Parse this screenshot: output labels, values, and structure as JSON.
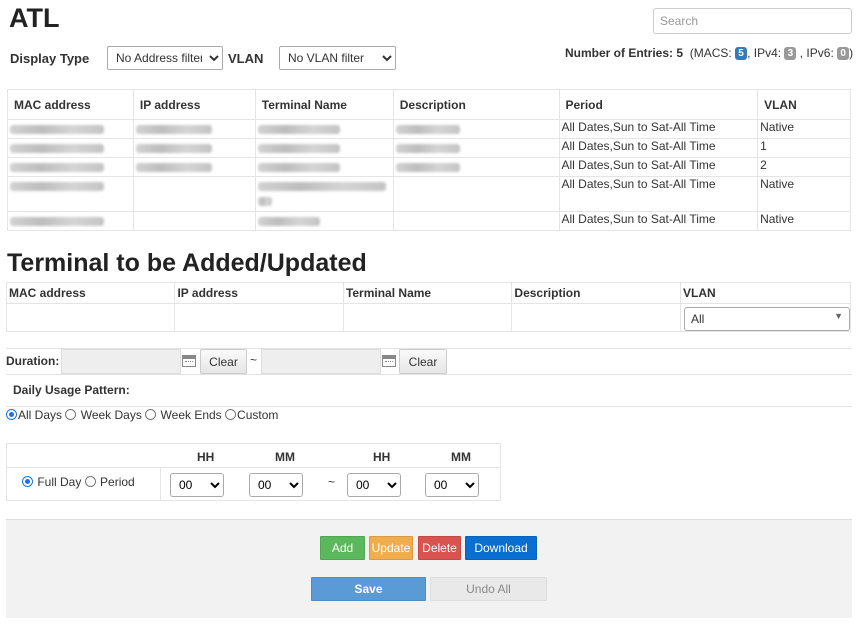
{
  "header": {
    "title": "ATL",
    "search_placeholder": "Search"
  },
  "filters": {
    "display_type_label": "Display Type",
    "display_type_value": "No Address filter",
    "vlan_label": "VLAN",
    "vlan_value": "No VLAN filter"
  },
  "entries": {
    "label": "Number of Entries:",
    "count": "5",
    "macs_label": "(MACS:",
    "macs": "5",
    "ipv4_label": ", IPv4:",
    "ipv4": "3",
    "ipv6_label": ", IPv6:",
    "ipv6": "0",
    "close": ")",
    "colors": {
      "macs": "#337ab7",
      "ipv4": "#999999",
      "ipv6": "#999999"
    }
  },
  "terminals_table": {
    "columns": [
      "MAC address",
      "IP address",
      "Terminal Name",
      "Description",
      "Period",
      "VLAN"
    ],
    "rows": [
      {
        "period": "All Dates,Sun to Sat-All Time",
        "vlan": "Native"
      },
      {
        "period": "All Dates,Sun to Sat-All Time",
        "vlan": "1"
      },
      {
        "period": "All Dates,Sun to Sat-All Time",
        "vlan": "2"
      },
      {
        "period": "All Dates,Sun to Sat-All Time",
        "vlan": "Native"
      },
      {
        "period": "All Dates,Sun to Sat-All Time",
        "vlan": "Native"
      }
    ]
  },
  "add_section": {
    "title": "Terminal to be Added/Updated",
    "columns": [
      "MAC address",
      "IP address",
      "Terminal Name",
      "Description",
      "VLAN"
    ],
    "vlan_value": "All"
  },
  "duration": {
    "label": "Duration:",
    "clear_label": "Clear",
    "separator": "~"
  },
  "daily_usage": {
    "label": "Daily Usage Pattern:",
    "options": [
      "All Days",
      "Week Days",
      "Week Ends",
      "Custom"
    ],
    "selected": "All Days"
  },
  "time": {
    "headers": [
      "HH",
      "MM",
      "HH",
      "MM"
    ],
    "full_day_label": "Full Day",
    "period_label": "Period",
    "separator": "~",
    "values": [
      "00",
      "00",
      "00",
      "00"
    ]
  },
  "actions": {
    "add_label": "Add",
    "update_label": "Update",
    "delete_label": "Delete",
    "download_label": "Download",
    "save_label": "Save",
    "undo_label": "Undo All",
    "colors": {
      "add": "#5cb85c",
      "update": "#f0ad4e",
      "delete": "#d9534f",
      "download": "#0a6fd0",
      "save": "#5b9bd5"
    }
  }
}
